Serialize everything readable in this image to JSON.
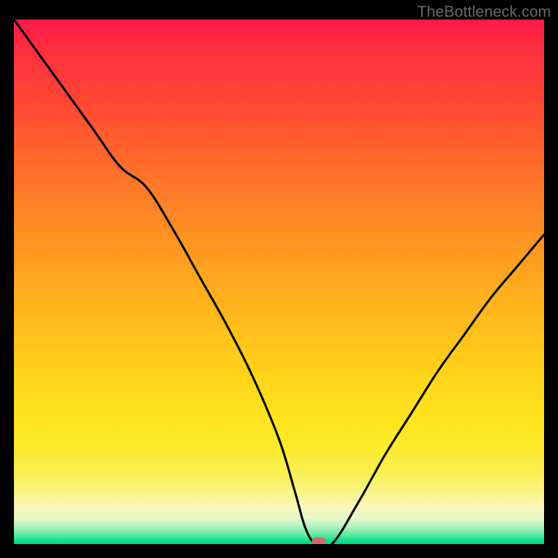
{
  "watermark": "TheBottleneck.com",
  "colors": {
    "curve": "#000000",
    "marker": "#cf6a6b",
    "frame": "#000000"
  },
  "chart_data": {
    "type": "line",
    "title": "",
    "xlabel": "",
    "ylabel": "",
    "xlim": [
      0,
      100
    ],
    "ylim": [
      0,
      100
    ],
    "grid": false,
    "series": [
      {
        "name": "bottleneck-curve",
        "x": [
          0,
          5,
          10,
          15,
          20,
          25,
          30,
          35,
          40,
          45,
          50,
          53,
          55,
          57,
          60,
          65,
          70,
          75,
          80,
          85,
          90,
          95,
          100
        ],
        "y": [
          100,
          93,
          86,
          79,
          72,
          68,
          60,
          51,
          42,
          32,
          20,
          10,
          3,
          0,
          0,
          8,
          17,
          25,
          33,
          40,
          47,
          53,
          59
        ]
      }
    ],
    "annotations": [
      {
        "name": "min-marker",
        "x": 57.5,
        "y": 0
      }
    ]
  }
}
